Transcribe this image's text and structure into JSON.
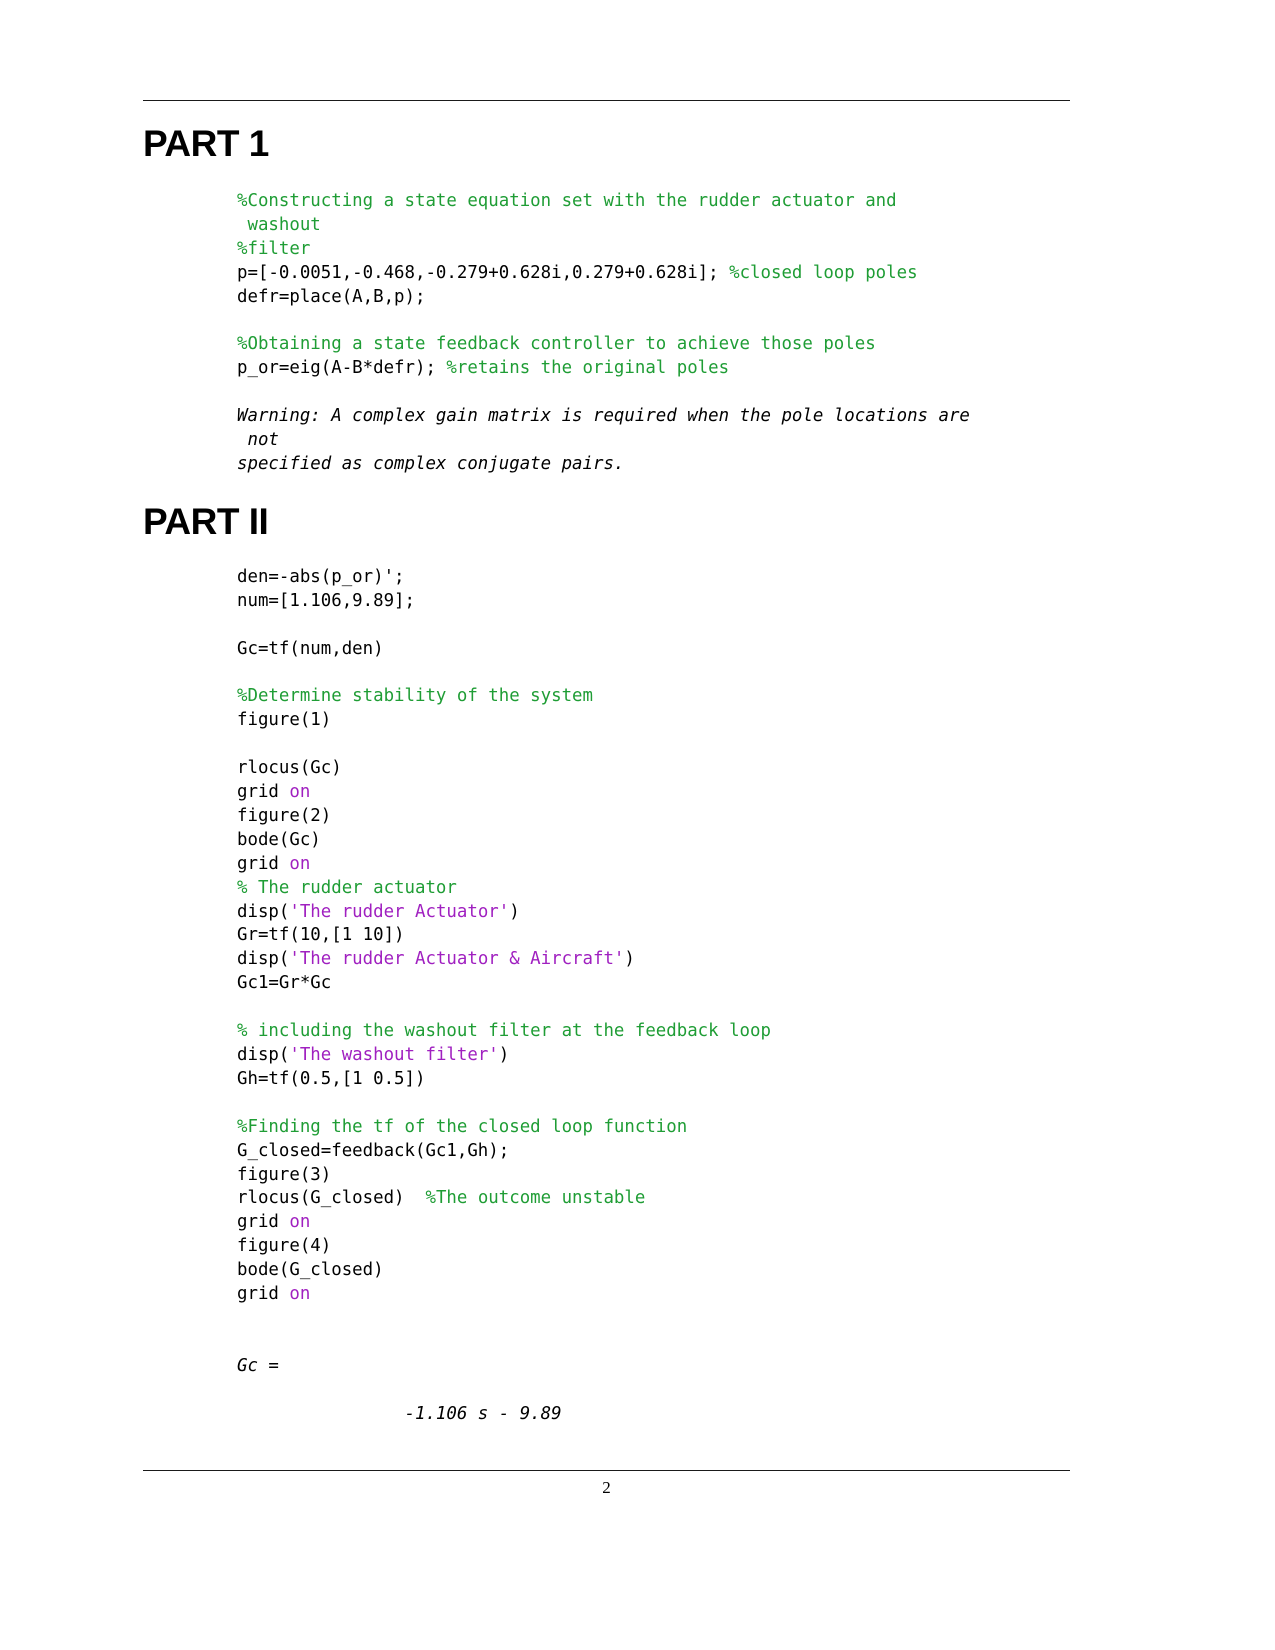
{
  "page": {
    "number": "2",
    "accent_comment_color": "#1f9d35",
    "accent_string_color": "#a020c0",
    "text_color": "#000000",
    "background": "#ffffff"
  },
  "sections": [
    {
      "heading": "PART 1",
      "lines": [
        {
          "id": "l1",
          "segments": [
            {
              "t": "%Constructing a state equation set with the rudder actuator and",
              "c": "cm"
            }
          ]
        },
        {
          "id": "l2",
          "segments": [
            {
              "t": " washout",
              "c": "cm"
            }
          ]
        },
        {
          "id": "l3",
          "segments": [
            {
              "t": "%filter",
              "c": "cm"
            }
          ]
        },
        {
          "id": "l4",
          "segments": [
            {
              "t": "p=[-0.0051,-0.468,-0.279+0.628i,0.279+0.628i]; ",
              "c": ""
            },
            {
              "t": "%closed loop poles",
              "c": "cm"
            }
          ]
        },
        {
          "id": "l5",
          "segments": [
            {
              "t": "defr=place(A,B,p);",
              "c": ""
            }
          ]
        },
        {
          "id": "l6",
          "segments": [
            {
              "t": " ",
              "c": ""
            }
          ]
        },
        {
          "id": "l7",
          "segments": [
            {
              "t": "%Obtaining a state feedback controller to achieve those poles",
              "c": "cm"
            }
          ]
        },
        {
          "id": "l8",
          "segments": [
            {
              "t": "p_or=eig(A-B*defr); ",
              "c": ""
            },
            {
              "t": "%retains the original poles",
              "c": "cm"
            }
          ]
        },
        {
          "id": "l9",
          "segments": [
            {
              "t": " ",
              "c": ""
            }
          ]
        },
        {
          "id": "l10",
          "segments": [
            {
              "t": "Warning: A complex gain matrix is required when the pole locations are",
              "c": "out"
            }
          ]
        },
        {
          "id": "l11",
          "segments": [
            {
              "t": " not",
              "c": "out"
            }
          ]
        },
        {
          "id": "l12",
          "segments": [
            {
              "t": "specified as complex conjugate pairs.",
              "c": "out"
            }
          ]
        }
      ]
    },
    {
      "heading": "PART II",
      "lines": [
        {
          "id": "m1",
          "segments": [
            {
              "t": "den=-abs(p_or)';",
              "c": ""
            }
          ]
        },
        {
          "id": "m2",
          "segments": [
            {
              "t": "num=[1.106,9.89];",
              "c": ""
            }
          ]
        },
        {
          "id": "m3",
          "segments": [
            {
              "t": " ",
              "c": ""
            }
          ]
        },
        {
          "id": "m4",
          "segments": [
            {
              "t": "Gc=tf(num,den)",
              "c": ""
            }
          ]
        },
        {
          "id": "m5",
          "segments": [
            {
              "t": " ",
              "c": ""
            }
          ]
        },
        {
          "id": "m6",
          "segments": [
            {
              "t": "%Determine stability of the system",
              "c": "cm"
            }
          ]
        },
        {
          "id": "m7",
          "segments": [
            {
              "t": "figure(1)",
              "c": ""
            }
          ]
        },
        {
          "id": "m8",
          "segments": [
            {
              "t": " ",
              "c": ""
            }
          ]
        },
        {
          "id": "m9",
          "segments": [
            {
              "t": "rlocus(Gc)",
              "c": ""
            }
          ]
        },
        {
          "id": "m10",
          "segments": [
            {
              "t": "grid ",
              "c": ""
            },
            {
              "t": "on",
              "c": "kw"
            }
          ]
        },
        {
          "id": "m11",
          "segments": [
            {
              "t": "figure(2)",
              "c": ""
            }
          ]
        },
        {
          "id": "m12",
          "segments": [
            {
              "t": "bode(Gc)",
              "c": ""
            }
          ]
        },
        {
          "id": "m13",
          "segments": [
            {
              "t": "grid ",
              "c": ""
            },
            {
              "t": "on",
              "c": "kw"
            }
          ]
        },
        {
          "id": "m14",
          "segments": [
            {
              "t": "% The rudder actuator",
              "c": "cm"
            }
          ]
        },
        {
          "id": "m15",
          "segments": [
            {
              "t": "disp(",
              "c": ""
            },
            {
              "t": "'The rudder Actuator'",
              "c": "str"
            },
            {
              "t": ")",
              "c": ""
            }
          ]
        },
        {
          "id": "m16",
          "segments": [
            {
              "t": "Gr=tf(10,[1 10])",
              "c": ""
            }
          ]
        },
        {
          "id": "m17",
          "segments": [
            {
              "t": "disp(",
              "c": ""
            },
            {
              "t": "'The rudder Actuator & Aircraft'",
              "c": "str"
            },
            {
              "t": ")",
              "c": ""
            }
          ]
        },
        {
          "id": "m18",
          "segments": [
            {
              "t": "Gc1=Gr*Gc",
              "c": ""
            }
          ]
        },
        {
          "id": "m19",
          "segments": [
            {
              "t": " ",
              "c": ""
            }
          ]
        },
        {
          "id": "m20",
          "segments": [
            {
              "t": "% including the washout filter at the feedback loop",
              "c": "cm"
            }
          ]
        },
        {
          "id": "m21",
          "segments": [
            {
              "t": "disp(",
              "c": ""
            },
            {
              "t": "'The washout filter'",
              "c": "str"
            },
            {
              "t": ")",
              "c": ""
            }
          ]
        },
        {
          "id": "m22",
          "segments": [
            {
              "t": "Gh=tf(0.5,[1 0.5])",
              "c": ""
            }
          ]
        },
        {
          "id": "m23",
          "segments": [
            {
              "t": " ",
              "c": ""
            }
          ]
        },
        {
          "id": "m24",
          "segments": [
            {
              "t": "%Finding the tf of the closed loop function",
              "c": "cm"
            }
          ]
        },
        {
          "id": "m25",
          "segments": [
            {
              "t": "G_closed=feedback(Gc1,Gh);",
              "c": ""
            }
          ]
        },
        {
          "id": "m26",
          "segments": [
            {
              "t": "figure(3)",
              "c": ""
            }
          ]
        },
        {
          "id": "m27",
          "segments": [
            {
              "t": "rlocus(G_closed)  ",
              "c": ""
            },
            {
              "t": "%The outcome unstable",
              "c": "cm"
            }
          ]
        },
        {
          "id": "m28",
          "segments": [
            {
              "t": "grid ",
              "c": ""
            },
            {
              "t": "on",
              "c": "kw"
            }
          ]
        },
        {
          "id": "m29",
          "segments": [
            {
              "t": "figure(4)",
              "c": ""
            }
          ]
        },
        {
          "id": "m30",
          "segments": [
            {
              "t": "bode(G_closed)",
              "c": ""
            }
          ]
        },
        {
          "id": "m31",
          "segments": [
            {
              "t": "grid ",
              "c": ""
            },
            {
              "t": "on",
              "c": "kw"
            }
          ]
        },
        {
          "id": "m32",
          "segments": [
            {
              "t": " ",
              "c": ""
            }
          ]
        },
        {
          "id": "m33",
          "segments": [
            {
              "t": " ",
              "c": ""
            }
          ]
        },
        {
          "id": "m34",
          "segments": [
            {
              "t": "Gc =",
              "c": "out"
            }
          ]
        },
        {
          "id": "m35",
          "segments": [
            {
              "t": " ",
              "c": ""
            }
          ]
        },
        {
          "id": "m36",
          "segments": [
            {
              "t": "                -1.106 s - 9.89",
              "c": "out"
            }
          ]
        }
      ]
    }
  ]
}
